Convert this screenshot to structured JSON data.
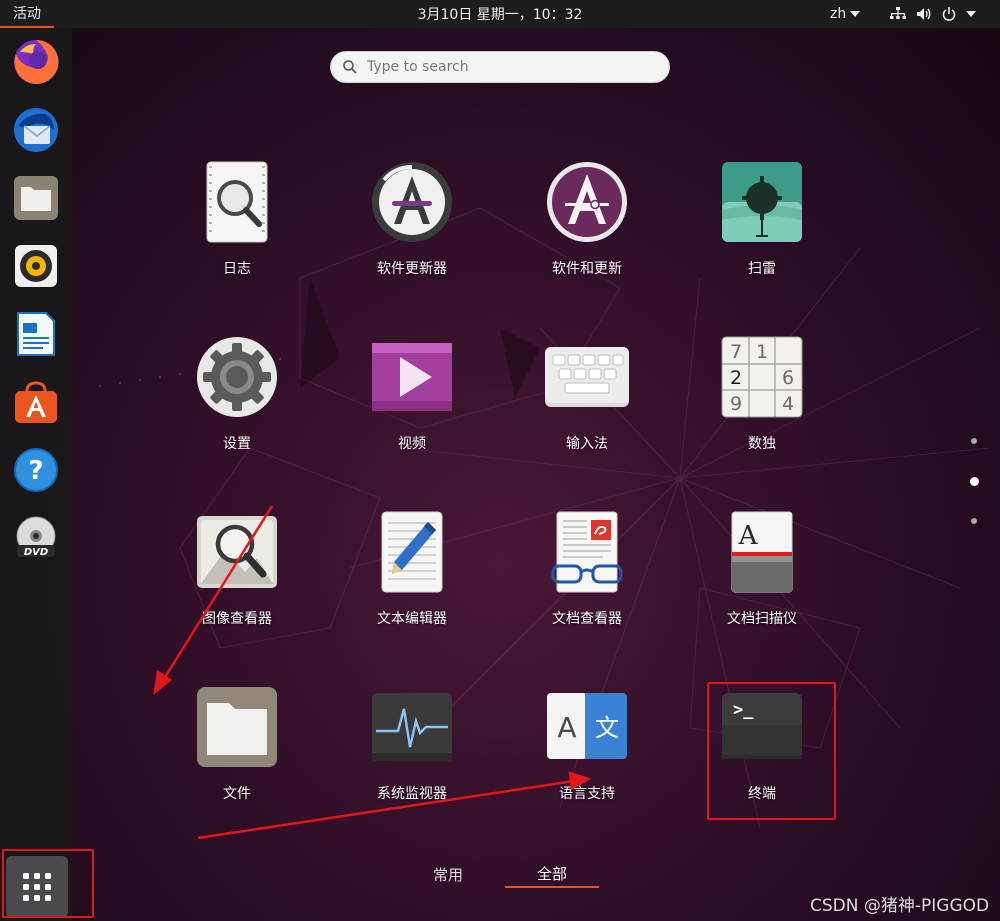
{
  "topbar": {
    "activities": "活动",
    "clock": "3月10日 星期一，10：32",
    "language": "zh"
  },
  "search": {
    "placeholder": "Type to search"
  },
  "dock": {
    "items": [
      "firefox-icon",
      "thunderbird-icon",
      "files-icon",
      "rhythmbox-icon",
      "libreoffice-writer-icon",
      "ubuntu-software-icon",
      "help-icon",
      "dvd-icon"
    ],
    "show_apps_icon": "grid-icon"
  },
  "apps": [
    {
      "label": "日志",
      "icon": "logs-icon"
    },
    {
      "label": "软件更新器",
      "icon": "software-updater-icon"
    },
    {
      "label": "软件和更新",
      "icon": "software-properties-icon"
    },
    {
      "label": "扫雷",
      "icon": "mines-icon"
    },
    {
      "label": "设置",
      "icon": "settings-icon"
    },
    {
      "label": "视频",
      "icon": "videos-icon"
    },
    {
      "label": "输入法",
      "icon": "input-method-icon"
    },
    {
      "label": "数独",
      "icon": "sudoku-icon"
    },
    {
      "label": "图像查看器",
      "icon": "image-viewer-icon"
    },
    {
      "label": "文本编辑器",
      "icon": "text-editor-icon"
    },
    {
      "label": "文档查看器",
      "icon": "document-viewer-icon"
    },
    {
      "label": "文档扫描仪",
      "icon": "document-scanner-icon"
    },
    {
      "label": "文件",
      "icon": "files-icon"
    },
    {
      "label": "系统监视器",
      "icon": "system-monitor-icon"
    },
    {
      "label": "语言支持",
      "icon": "language-support-icon"
    },
    {
      "label": "终端",
      "icon": "terminal-icon"
    }
  ],
  "sudoku": [
    "7",
    "1",
    "2",
    "6",
    "9",
    "4"
  ],
  "terminal_prompt": ">_",
  "language_support_glyphs": [
    "A",
    "文"
  ],
  "scanner_glyph": "A",
  "tabs": {
    "frequent": "常用",
    "all": "全部"
  },
  "watermark": "CSDN @猪神-PIGGOD",
  "colors": {
    "accent": "#e95420",
    "annotation": "#e3161b"
  }
}
